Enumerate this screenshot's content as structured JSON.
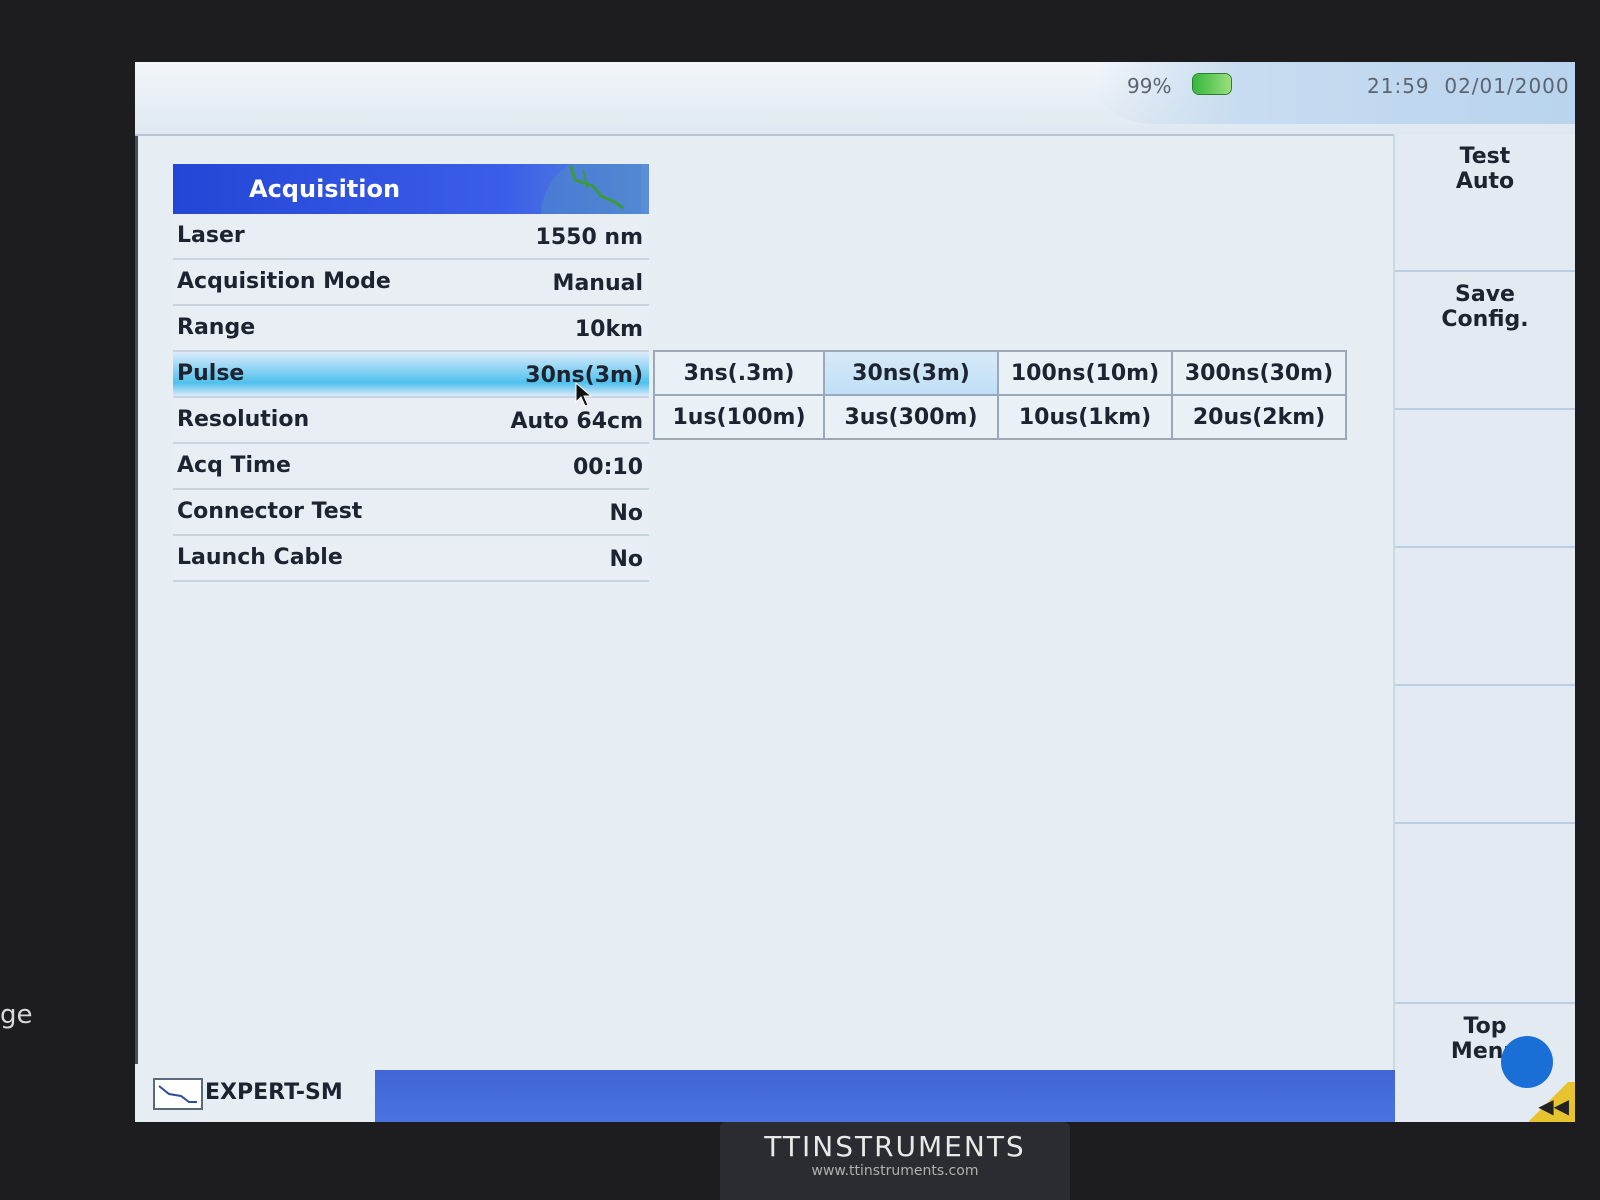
{
  "bezel": {
    "side_text": "ge"
  },
  "status": {
    "battery": "99%",
    "time": "21:59",
    "date": "02/01/2000"
  },
  "acquisition": {
    "title": "Acquisition",
    "rows": [
      {
        "label": "Laser",
        "value": "1550 nm"
      },
      {
        "label": "Acquisition Mode",
        "value": "Manual"
      },
      {
        "label": "Range",
        "value": "10km"
      },
      {
        "label": "Pulse",
        "value": "30ns(3m)"
      },
      {
        "label": "Resolution",
        "value": "Auto 64cm"
      },
      {
        "label": "Acq Time",
        "value": "00:10"
      },
      {
        "label": "Connector Test",
        "value": "No"
      },
      {
        "label": "Launch Cable",
        "value": "No"
      }
    ]
  },
  "pulse_options": [
    "3ns(.3m)",
    "30ns(3m)",
    "100ns(10m)",
    "300ns(30m)",
    "1us(100m)",
    "3us(300m)",
    "10us(1km)",
    "20us(2km)"
  ],
  "softkeys": {
    "test_auto": "Test\nAuto",
    "save_config": "Save\nConfig.",
    "top_menu": "Top\nMenu"
  },
  "footer": {
    "mode": "EXPERT-SM"
  },
  "brand": {
    "name": "TTINSTRUMENTS",
    "url": "www.ttinstruments.com"
  },
  "colors": {
    "header_blue": "#2346d6",
    "selection_cyan": "#4fc1ee",
    "footer_blue": "#4a73e0"
  }
}
